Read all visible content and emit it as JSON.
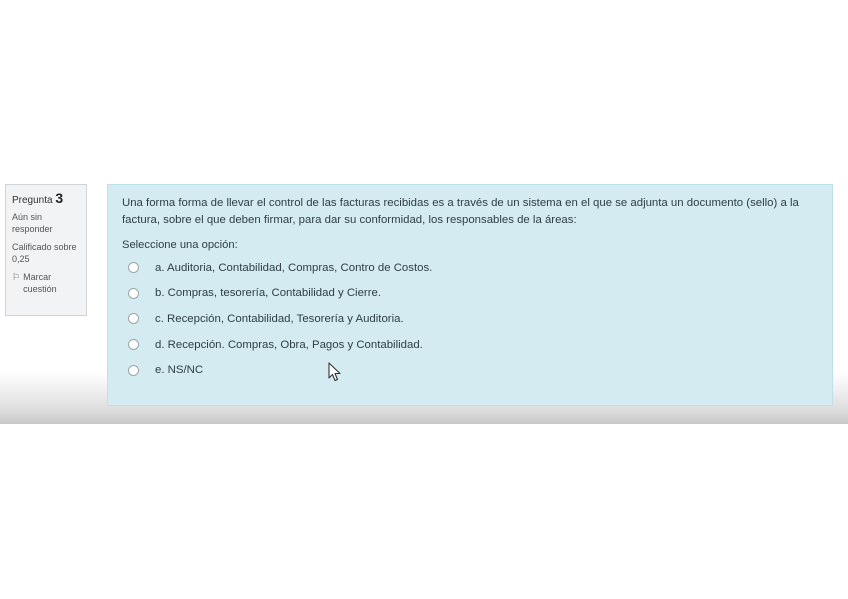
{
  "question_info": {
    "number_label": "Pregunta",
    "number": "3",
    "state": "Aún sin responder",
    "grade_label": "Calificado sobre",
    "grade_value": "0,25",
    "flag_label": "Marcar cuestión"
  },
  "question": {
    "text": "Una forma forma de llevar el control de las facturas recibidas es a través de un sistema en el que se adjunta un documento  (sello) a la factura, sobre el que deben firmar, para dar su conformidad, los responsables de la áreas:",
    "prompt": "Seleccione una opción:",
    "options": [
      {
        "label": "a. Auditoria, Contabilidad, Compras, Contro de Costos.",
        "selected": false
      },
      {
        "label": "b. Compras, tesorería, Contabilidad y Cierre.",
        "selected": false
      },
      {
        "label": "c. Recepción, Contabilidad, Tesorería y Auditoria.",
        "selected": false
      },
      {
        "label": "d. Recepción. Compras, Obra, Pagos y Contabilidad.",
        "selected": true
      },
      {
        "label": "e. NS/NC",
        "selected": false
      }
    ]
  },
  "colors": {
    "content_bg": "#d3ebf1",
    "info_bg": "#f1f3f5",
    "radio_selected": "#1a73e8"
  }
}
